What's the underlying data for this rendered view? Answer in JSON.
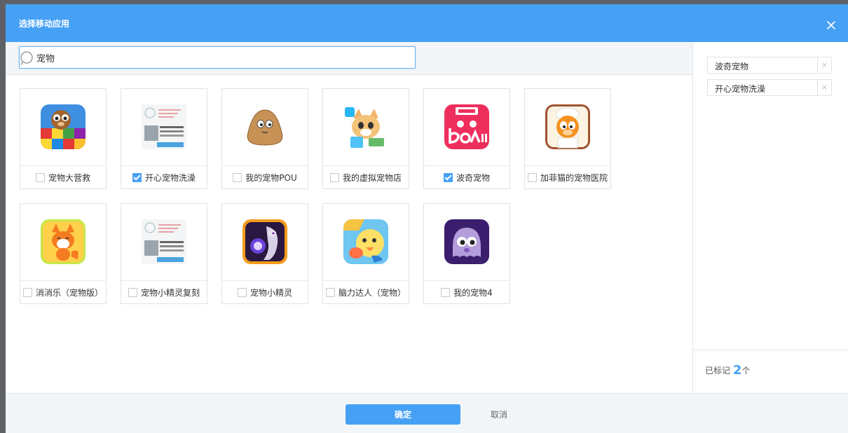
{
  "dialog": {
    "title": "选择移动应用",
    "close_icon": "close-icon",
    "accent_color": "#46a1f5"
  },
  "search": {
    "value": "宠物",
    "icon": "search-icon"
  },
  "apps": [
    {
      "name": "宠物大营救",
      "checked": false,
      "icon": "pet-rescue-game-icon"
    },
    {
      "name": "开心宠物洗澡",
      "checked": true,
      "icon": "placeholder-poster-icon"
    },
    {
      "name": "我的宠物POU",
      "checked": false,
      "icon": "pou-blob-icon"
    },
    {
      "name": "我的虚拟宠物店",
      "checked": false,
      "icon": "cartoon-dog-icon"
    },
    {
      "name": "波奇宠物",
      "checked": true,
      "icon": "boqii-logo-icon"
    },
    {
      "name": "加菲猫的宠物医院",
      "checked": false,
      "icon": "garfield-icon"
    },
    {
      "name": "消消乐（宠物版）",
      "checked": false,
      "icon": "fox-cartoon-icon"
    },
    {
      "name": "宠物小精灵复刻",
      "checked": false,
      "icon": "placeholder-poster-icon"
    },
    {
      "name": "宠物小精灵",
      "checked": false,
      "icon": "mewtwo-icon"
    },
    {
      "name": "脑力达人（宠物）",
      "checked": false,
      "icon": "chick-cartoon-icon"
    },
    {
      "name": "我的宠物4",
      "checked": false,
      "icon": "purple-moy-icon"
    }
  ],
  "selected": {
    "tags": [
      "波奇宠物",
      "开心宠物洗澡"
    ],
    "remove_glyph": "×",
    "marked_prefix": "已标记",
    "marked_count": "2",
    "marked_suffix": "个"
  },
  "footer": {
    "ok_label": "确定",
    "cancel_label": "取消"
  }
}
